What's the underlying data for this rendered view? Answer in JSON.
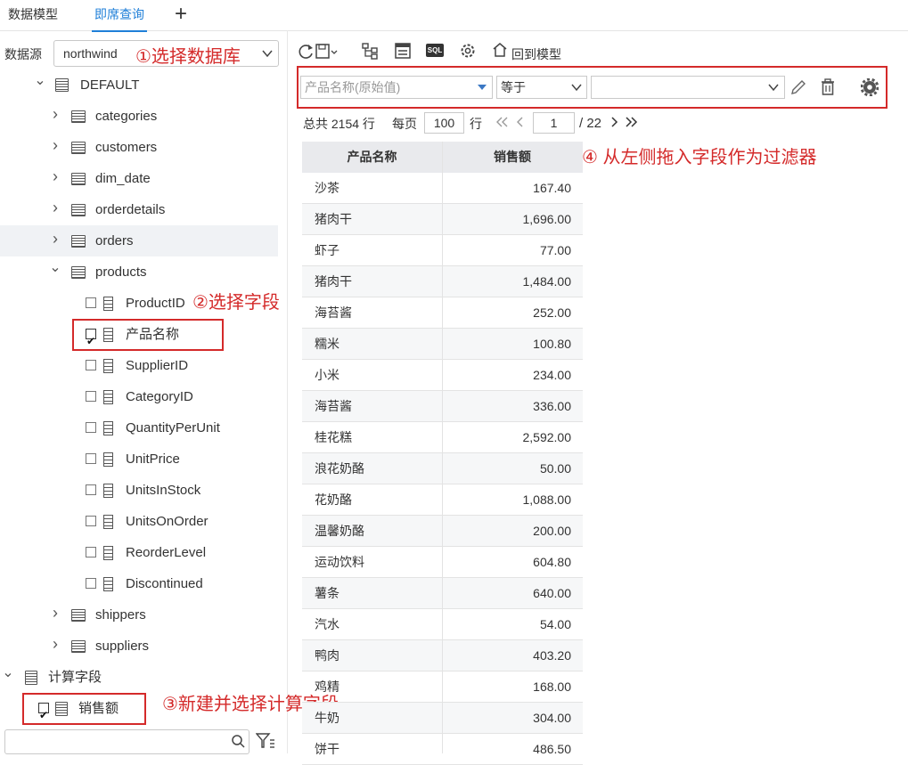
{
  "tabs": [
    {
      "label": "数据模型"
    },
    {
      "label": "即席查询"
    }
  ],
  "add_tab": "+",
  "datasource": {
    "label": "数据源",
    "value": "northwind"
  },
  "tree": {
    "root": "DEFAULT",
    "tables": [
      "categories",
      "customers",
      "dim_date",
      "orderdetails",
      "orders",
      "products"
    ],
    "product_fields": [
      {
        "label": "ProductID",
        "checked": false
      },
      {
        "label": "产品名称",
        "checked": true
      },
      {
        "label": "SupplierID",
        "checked": false
      },
      {
        "label": "CategoryID",
        "checked": false
      },
      {
        "label": "QuantityPerUnit",
        "checked": false
      },
      {
        "label": "UnitPrice",
        "checked": false
      },
      {
        "label": "UnitsInStock",
        "checked": false
      },
      {
        "label": "UnitsOnOrder",
        "checked": false
      },
      {
        "label": "ReorderLevel",
        "checked": false
      },
      {
        "label": "Discontinued",
        "checked": false
      }
    ],
    "tables_after": [
      "shippers",
      "suppliers"
    ],
    "calc_group": "计算字段",
    "calc_field": {
      "label": "销售额",
      "checked": true
    }
  },
  "annotations": {
    "a1": "①选择数据库",
    "a2": "②选择字段",
    "a3": "③新建并选择计算字段",
    "a4": "④ 从左侧拖入字段作为过滤器"
  },
  "toolbar": {
    "back_to_model": "回到模型",
    "sql": "SQL"
  },
  "filter": {
    "field_placeholder": "产品名称(原始值)",
    "operator": "等于",
    "value": ""
  },
  "pager": {
    "total": "总共 2154 行",
    "per_page_label": "每页",
    "per_page": "100",
    "rows_suffix": "行",
    "current": "1",
    "pages": "/ 22"
  },
  "grid": {
    "columns": [
      "产品名称",
      "销售额"
    ],
    "rows": [
      [
        "沙茶",
        "167.40"
      ],
      [
        "猪肉干",
        "1,696.00"
      ],
      [
        "虾子",
        "77.00"
      ],
      [
        "猪肉干",
        "1,484.00"
      ],
      [
        "海苔酱",
        "252.00"
      ],
      [
        "糯米",
        "100.80"
      ],
      [
        "小米",
        "234.00"
      ],
      [
        "海苔酱",
        "336.00"
      ],
      [
        "桂花糕",
        "2,592.00"
      ],
      [
        "浪花奶酪",
        "50.00"
      ],
      [
        "花奶酪",
        "1,088.00"
      ],
      [
        "温馨奶酪",
        "200.00"
      ],
      [
        "运动饮料",
        "604.80"
      ],
      [
        "薯条",
        "640.00"
      ],
      [
        "汽水",
        "54.00"
      ],
      [
        "鸭肉",
        "403.20"
      ],
      [
        "鸡精",
        "168.00"
      ],
      [
        "牛奶",
        "304.00"
      ],
      [
        "饼干",
        "486.50"
      ]
    ]
  },
  "search": {
    "placeholder": ""
  }
}
